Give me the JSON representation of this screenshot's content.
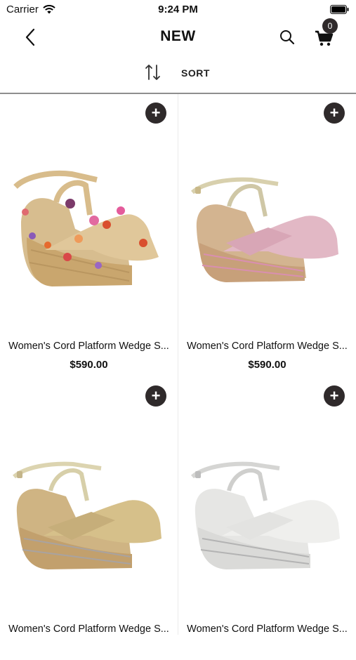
{
  "status_bar": {
    "carrier": "Carrier",
    "time": "9:24 PM"
  },
  "nav": {
    "title": "NEW",
    "cart_count": "0"
  },
  "sort": {
    "label": "SORT"
  },
  "products": [
    {
      "name": "Women's Cord Platform Wedge S...",
      "price": "$590.00",
      "variant": "floral raffia"
    },
    {
      "name": "Women's Cord Platform Wedge S...",
      "price": "$590.00",
      "variant": "pink metallic"
    },
    {
      "name": "Women's Cord Platform Wedge S...",
      "price": "",
      "variant": "gold metallic"
    },
    {
      "name": "Women's Cord Platform Wedge S...",
      "price": "",
      "variant": "white silver"
    }
  ],
  "colors": {
    "accent_dark": "#2f2a2b",
    "divider": "#8e8e8e"
  }
}
